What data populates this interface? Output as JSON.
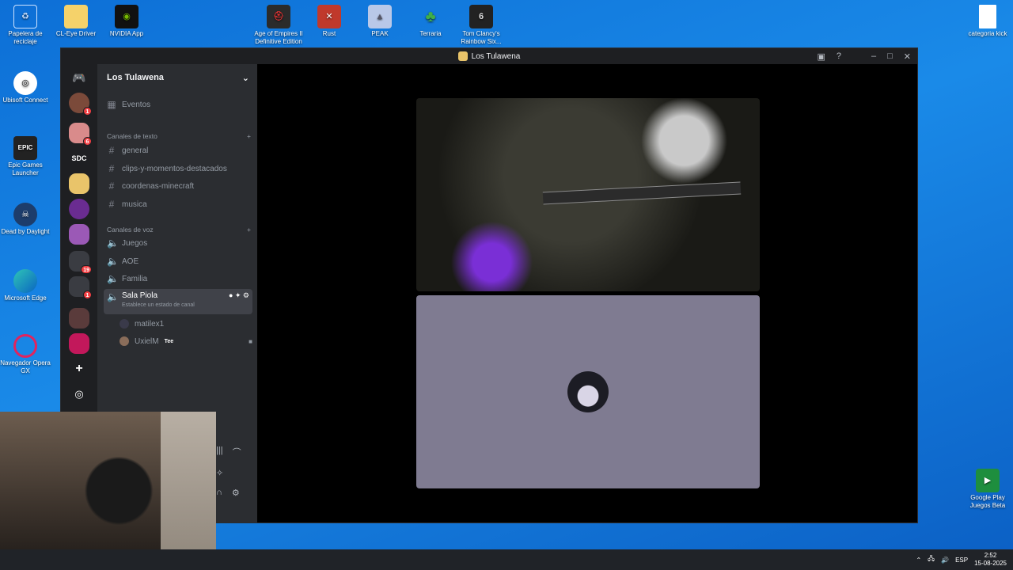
{
  "desktop": {
    "icons": [
      {
        "label": "Papelera de reciclaje",
        "icon": "recycle-bin-icon"
      },
      {
        "label": "CL-Eye Driver",
        "icon": "folder-icon"
      },
      {
        "label": "NVIDIA App",
        "icon": "nvidia-icon"
      },
      {
        "label": "Age of Empires II Definitive Edition",
        "icon": "aoe-icon"
      },
      {
        "label": "Rust",
        "icon": "rust-icon"
      },
      {
        "label": "PEAK",
        "icon": "peak-icon"
      },
      {
        "label": "Terraria",
        "icon": "terraria-icon"
      },
      {
        "label": "Tom Clancy's Rainbow Six...",
        "icon": "rainbow-six-icon"
      },
      {
        "label": "categoria kick",
        "icon": "text-file-icon"
      },
      {
        "label": "Ubisoft Connect",
        "icon": "ubisoft-icon"
      },
      {
        "label": "Epic Games Launcher",
        "icon": "epic-icon"
      },
      {
        "label": "Dead by Daylight",
        "icon": "dbd-icon"
      },
      {
        "label": "Microsoft Edge",
        "icon": "edge-icon"
      },
      {
        "label": "Navegador Opera GX",
        "icon": "opera-gx-icon"
      },
      {
        "label": "Google Play Juegos Beta",
        "icon": "google-play-games-icon"
      }
    ]
  },
  "window": {
    "title": "Los Tulawena"
  },
  "guilds": {
    "badges": [
      "1",
      "6",
      "19",
      "1"
    ],
    "sdc_label": "SDC"
  },
  "server": {
    "name": "Los Tulawena",
    "events_label": "Eventos",
    "text_category": "Canales de texto",
    "text_channels": [
      "general",
      "clips-y-momentos-destacados",
      "coordenas-minecraft",
      "musica"
    ],
    "voice_category": "Canales de voz",
    "voice_channels": [
      "Juegos",
      "AOE",
      "Familia",
      "Sala Piola"
    ],
    "active_status": "Establece un estado de canal",
    "voice_users": [
      {
        "name": "matilex1"
      },
      {
        "name": "UxielM",
        "tag": "Tee"
      }
    ]
  },
  "taskbar": {
    "lang": "ESP",
    "time": "2:52",
    "date": "15-08-2025"
  },
  "colors": {
    "accent": "#5865f2",
    "desktop_blue": "#1a8ae8",
    "danger": "#f23f43"
  }
}
